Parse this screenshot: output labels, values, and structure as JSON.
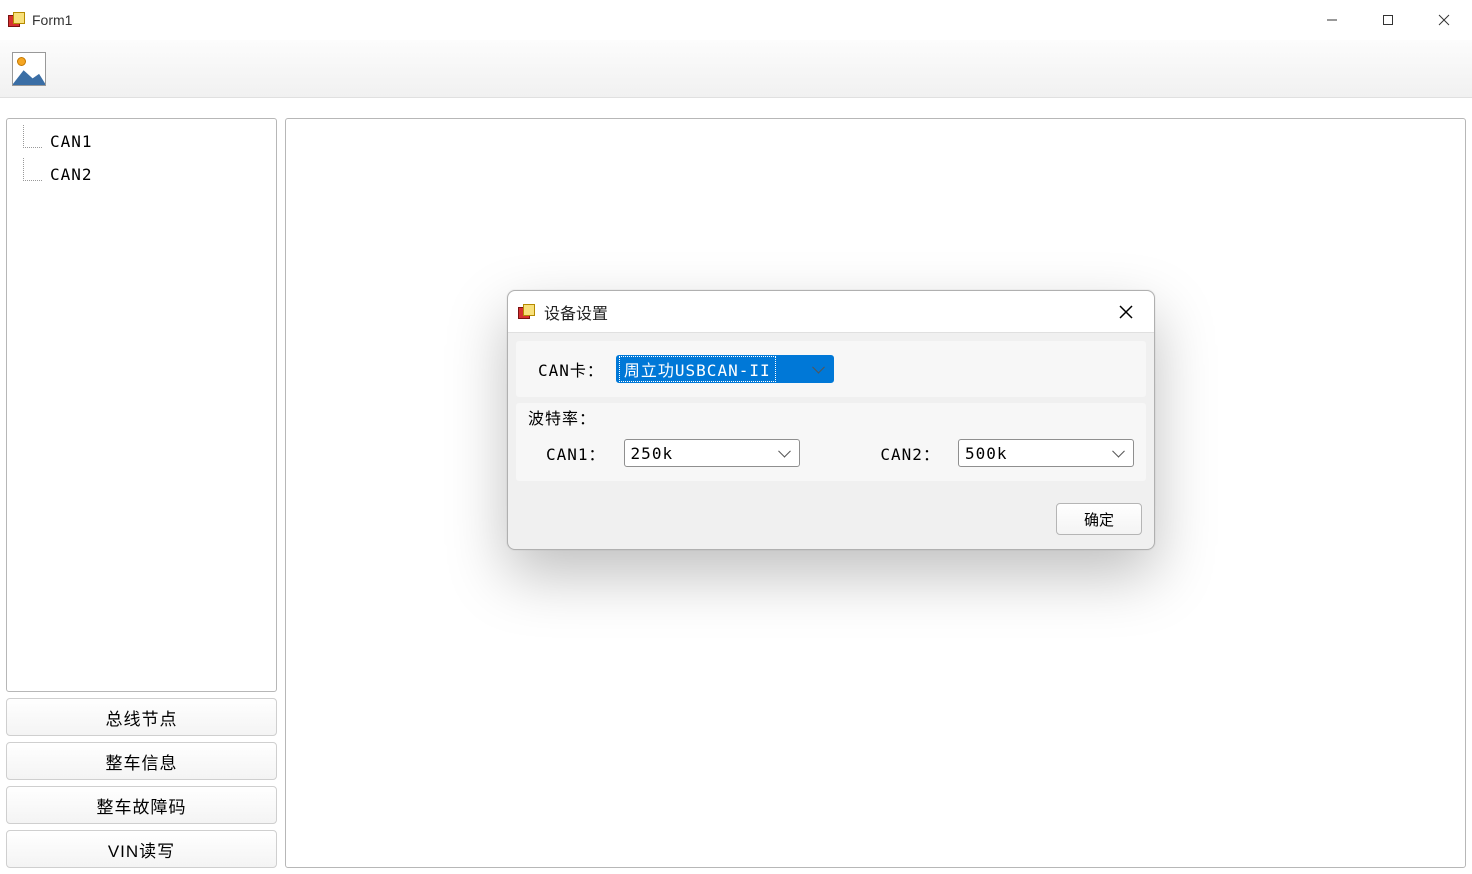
{
  "window": {
    "title": "Form1"
  },
  "tree": {
    "items": [
      {
        "label": "CAN1"
      },
      {
        "label": "CAN2"
      }
    ]
  },
  "sidebar_buttons": [
    {
      "label": "总线节点"
    },
    {
      "label": "整车信息"
    },
    {
      "label": "整车故障码"
    },
    {
      "label": "VIN读写"
    }
  ],
  "dialog": {
    "title": "设备设置",
    "can_card_label": "CAN卡：",
    "can_card_value": "周立功USBCAN-II",
    "baud_label": "波特率：",
    "can1_label": "CAN1：",
    "can1_value": "250k",
    "can2_label": "CAN2：",
    "can2_value": "500k",
    "ok_label": "确定"
  }
}
